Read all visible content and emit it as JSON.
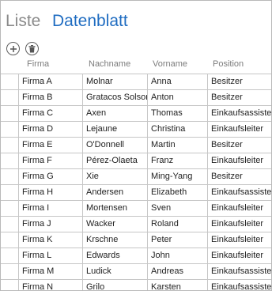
{
  "view_tabs": {
    "list": "Liste",
    "datasheet": "Datenblatt"
  },
  "toolbar": {
    "add_icon": "plus-circle-icon",
    "delete_icon": "trash-circle-icon"
  },
  "columns": [
    "Firma",
    "Nachname",
    "Vorname",
    "Position"
  ],
  "rows": [
    [
      "Firma A",
      "Molnar",
      "Anna",
      "Besitzer"
    ],
    [
      "Firma B",
      "Gratacos Solsona",
      "Anton",
      "Besitzer"
    ],
    [
      "Firma C",
      "Axen",
      "Thomas",
      "Einkaufsassistent"
    ],
    [
      "Firma D",
      "Lejaune",
      "Christina",
      "Einkaufsleiter"
    ],
    [
      "Firma E",
      "O'Donnell",
      "Martin",
      "Besitzer"
    ],
    [
      "Firma F",
      "Pérez-Olaeta",
      "Franz",
      "Einkaufsleiter"
    ],
    [
      "Firma G",
      "Xie",
      "Ming-Yang",
      "Besitzer"
    ],
    [
      "Firma H",
      "Andersen",
      "Elizabeth",
      "Einkaufsassistent"
    ],
    [
      "Firma I",
      "Mortensen",
      "Sven",
      "Einkaufsleiter"
    ],
    [
      "Firma J",
      "Wacker",
      "Roland",
      "Einkaufsleiter"
    ],
    [
      "Firma K",
      "Krschne",
      "Peter",
      "Einkaufsleiter"
    ],
    [
      "Firma L",
      "Edwards",
      "John",
      "Einkaufsleiter"
    ],
    [
      "Firma M",
      "Ludick",
      "Andreas",
      "Einkaufsassistent"
    ],
    [
      "Firma N",
      "Grilo",
      "Karsten",
      "Einkaufsassistent"
    ]
  ]
}
